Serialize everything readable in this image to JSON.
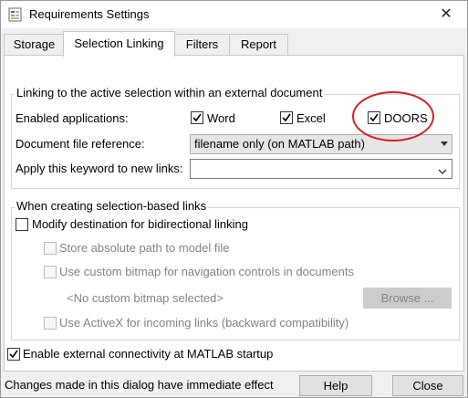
{
  "window": {
    "title": "Requirements Settings",
    "close_glyph": "✕",
    "app_icon": "matlab-requirements-icon"
  },
  "tabs": [
    {
      "label": "Storage",
      "active": false
    },
    {
      "label": "Selection Linking",
      "active": true
    },
    {
      "label": "Filters",
      "active": false
    },
    {
      "label": "Report",
      "active": false
    }
  ],
  "group1": {
    "legend": "Linking to the active selection within an external document",
    "enabled_apps_label": "Enabled applications:",
    "apps": [
      {
        "label": "Word",
        "checked": true
      },
      {
        "label": "Excel",
        "checked": true
      },
      {
        "label": "DOORS",
        "checked": true
      }
    ],
    "doc_ref_label": "Document file reference:",
    "doc_ref_value": "filename only (on MATLAB path)",
    "keyword_label": "Apply this keyword to new links:",
    "keyword_value": ""
  },
  "group2": {
    "legend": "When creating selection-based links",
    "modify_dest": {
      "label": "Modify destination for bidirectional linking",
      "checked": false
    },
    "store_abs": {
      "label": "Store absolute path to model file",
      "checked": false,
      "enabled": false
    },
    "custom_bitmap": {
      "label": "Use custom bitmap for navigation controls in documents",
      "checked": false,
      "enabled": false
    },
    "no_bitmap_text": "<No custom bitmap selected>",
    "browse_label": "Browse ...",
    "activex": {
      "label": "Use ActiveX for incoming links (backward compatibility)",
      "checked": false,
      "enabled": false
    }
  },
  "enable_external": {
    "label": "Enable external connectivity at MATLAB startup",
    "checked": true
  },
  "status": {
    "message": "Changes made in this dialog have immediate effect",
    "help_label": "Help",
    "close_label": "Close"
  },
  "colors": {
    "annotation_ellipse": "#d62020"
  }
}
